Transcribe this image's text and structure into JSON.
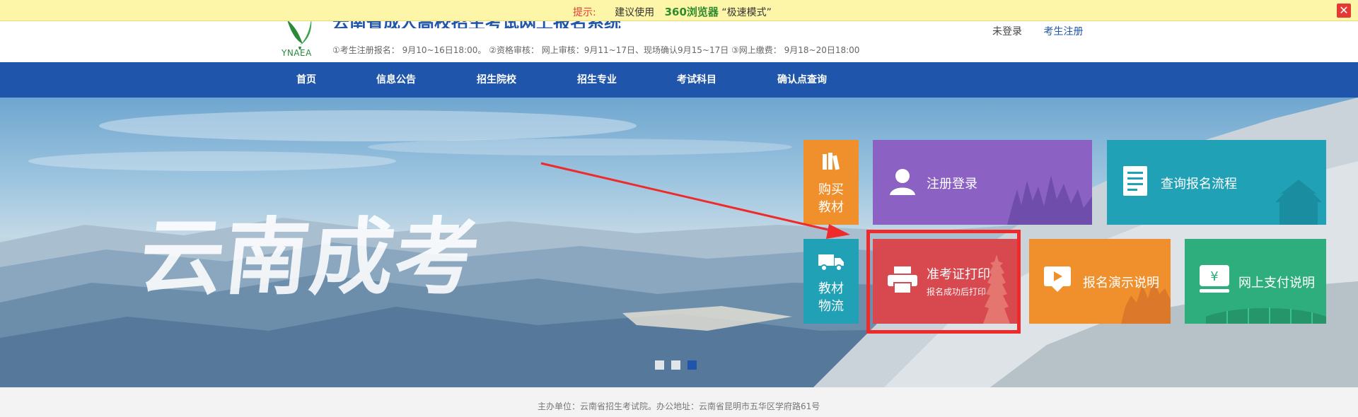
{
  "notice": {
    "label": "提示:",
    "prefix": "建议使用",
    "browser": "360浏览器",
    "mode": "“极速模式”",
    "close_icon": "close-icon"
  },
  "header": {
    "logo_text": "YNAEA",
    "title": "云南省成人高校招生考试网上报名系统",
    "schedule": "①考生注册报名： 9月10~16日18:00。 ②资格审核： 网上审核：9月11~17日、现场确认9月15~17日 ③网上缴费： 9月18~20日18:00",
    "login_status": "未登录",
    "register_link": "考生注册"
  },
  "nav": {
    "items": [
      "首页",
      "信息公告",
      "招生院校",
      "招生专业",
      "考试科目",
      "确认点查询"
    ]
  },
  "banner": {
    "calligraphy": "云南成考",
    "dots": 3,
    "active_dot": 2
  },
  "tiles": {
    "buy_books": {
      "line1": "购买",
      "line2": "教材",
      "color": "#f0902c",
      "icon": "books-icon"
    },
    "book_logistics": {
      "line1": "教材",
      "line2": "物流",
      "color": "#21a1b6",
      "icon": "truck-icon"
    },
    "register_login": {
      "label": "注册登录",
      "color": "#8b62c4",
      "icon": "user-icon"
    },
    "query_process": {
      "label": "查询报名流程",
      "color": "#21a1b6",
      "icon": "document-icon"
    },
    "admission_print": {
      "label": "准考证打印",
      "sub": "报名成功后打印",
      "color": "#d8484f",
      "icon": "printer-icon"
    },
    "demo_guide": {
      "label": "报名演示说明",
      "color": "#f0902c",
      "icon": "video-icon"
    },
    "payment_guide": {
      "label": "网上支付说明",
      "color": "#2fae7d",
      "icon": "yuan-icon"
    }
  },
  "annotation": {
    "color": "#ee2a2a"
  },
  "footer": {
    "text": "主办单位：云南省招生考试院。办公地址：云南省昆明市五华区学府路61号"
  }
}
